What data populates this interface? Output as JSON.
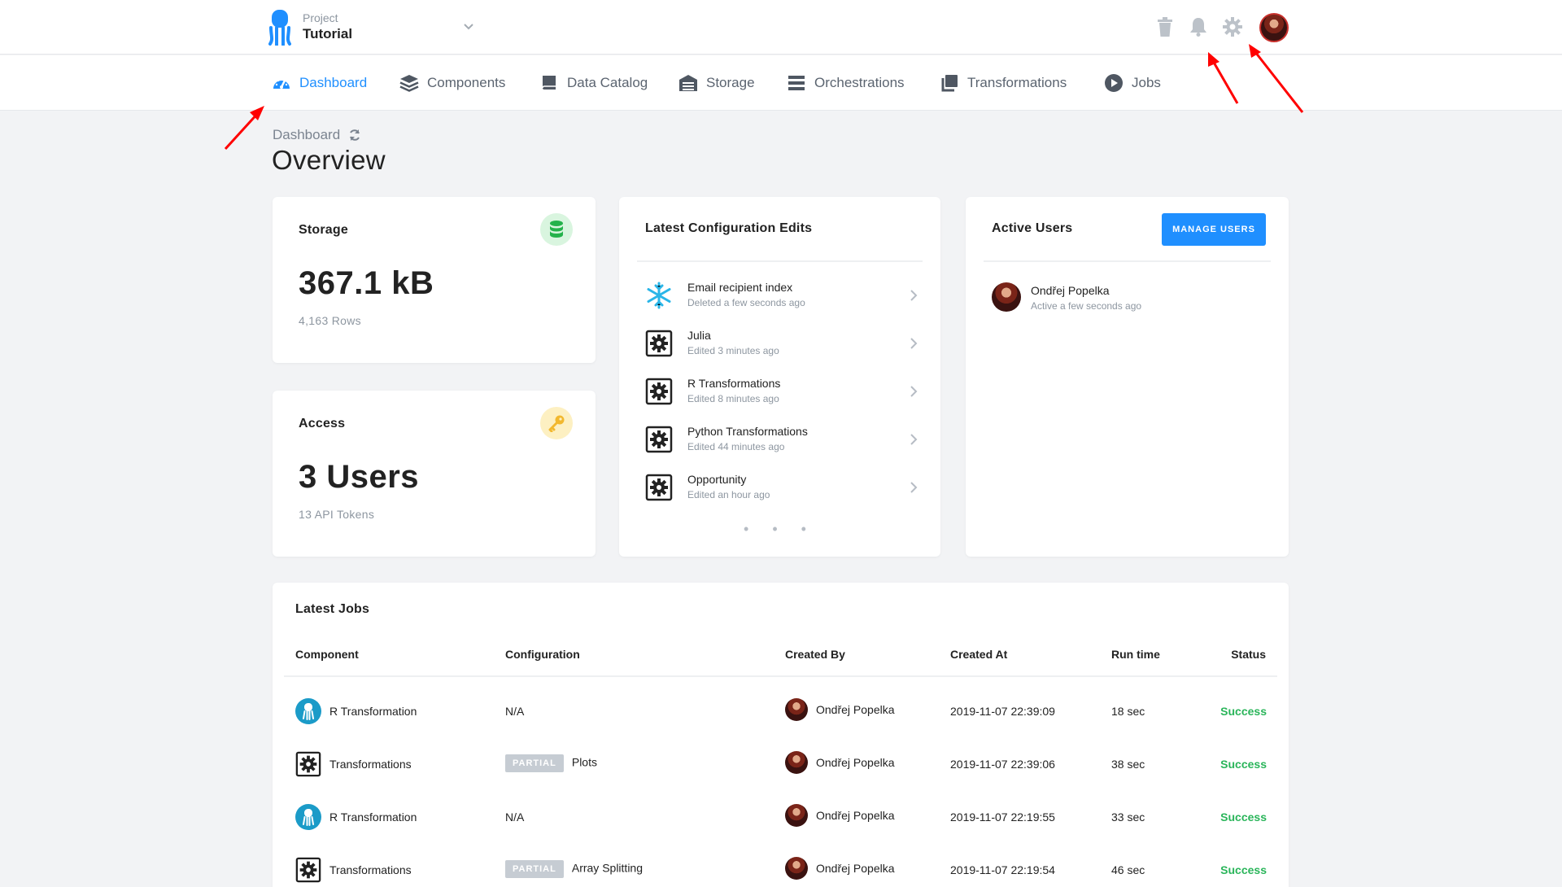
{
  "project": {
    "label": "Project",
    "name": "Tutorial"
  },
  "nav": [
    {
      "label": "Dashboard",
      "icon": "dashboard-icon",
      "active": true
    },
    {
      "label": "Components",
      "icon": "layers-icon"
    },
    {
      "label": "Data Catalog",
      "icon": "book-icon"
    },
    {
      "label": "Storage",
      "icon": "warehouse-icon"
    },
    {
      "label": "Orchestrations",
      "icon": "list-icon"
    },
    {
      "label": "Transformations",
      "icon": "copy-icon"
    },
    {
      "label": "Jobs",
      "icon": "play-icon"
    }
  ],
  "header_icons": [
    "trash-icon",
    "bell-icon",
    "gear-icon",
    "avatar"
  ],
  "page": {
    "breadcrumb": "Dashboard",
    "title": "Overview"
  },
  "storage": {
    "title": "Storage",
    "value": "367.1 kB",
    "sub": "4,163 Rows",
    "icon_color": "#24b24b"
  },
  "access": {
    "title": "Access",
    "value": "3 Users",
    "sub": "13 API Tokens",
    "icon_color": "#f2b82e"
  },
  "edits": {
    "title": "Latest Configuration Edits",
    "items": [
      {
        "name": "Email recipient index",
        "time": "Deleted a few seconds ago",
        "icon": "snowflake-icon"
      },
      {
        "name": "Julia",
        "time": "Edited 3 minutes ago",
        "icon": "gear-box-icon"
      },
      {
        "name": "R Transformations",
        "time": "Edited 8 minutes ago",
        "icon": "gear-box-icon"
      },
      {
        "name": "Python Transformations",
        "time": "Edited 44 minutes ago",
        "icon": "gear-box-icon"
      },
      {
        "name": "Opportunity",
        "time": "Edited an hour ago",
        "icon": "gear-box-icon"
      }
    ],
    "more": "• • •"
  },
  "users": {
    "title": "Active Users",
    "button": "MANAGE USERS",
    "items": [
      {
        "name": "Ondřej Popelka",
        "status": "Active a few seconds ago"
      }
    ]
  },
  "jobs": {
    "title": "Latest Jobs",
    "columns": [
      "Component",
      "Configuration",
      "Created By",
      "Created At",
      "Run time",
      "Status"
    ],
    "partial_label": "PARTIAL",
    "rows": [
      {
        "component": "R Transformation",
        "configuration": "N/A",
        "partial": false,
        "created_by": "Ondřej Popelka",
        "created_at": "2019-11-07 22:39:09",
        "run_time": "18 sec",
        "status": "Success",
        "icon": "r-transformation-icon"
      },
      {
        "component": "Transformations",
        "configuration": "Plots",
        "partial": true,
        "created_by": "Ondřej Popelka",
        "created_at": "2019-11-07 22:39:06",
        "run_time": "38 sec",
        "status": "Success",
        "icon": "gear-box-icon"
      },
      {
        "component": "R Transformation",
        "configuration": "N/A",
        "partial": false,
        "created_by": "Ondřej Popelka",
        "created_at": "2019-11-07 22:19:55",
        "run_time": "33 sec",
        "status": "Success",
        "icon": "r-transformation-icon"
      },
      {
        "component": "Transformations",
        "configuration": "Array Splitting",
        "partial": true,
        "created_by": "Ondřej Popelka",
        "created_at": "2019-11-07 22:19:54",
        "run_time": "46 sec",
        "status": "Success",
        "icon": "gear-box-icon"
      }
    ]
  },
  "colors": {
    "accent": "#1f8fff",
    "success": "#2ab55a",
    "annotation": "#ff0000"
  }
}
